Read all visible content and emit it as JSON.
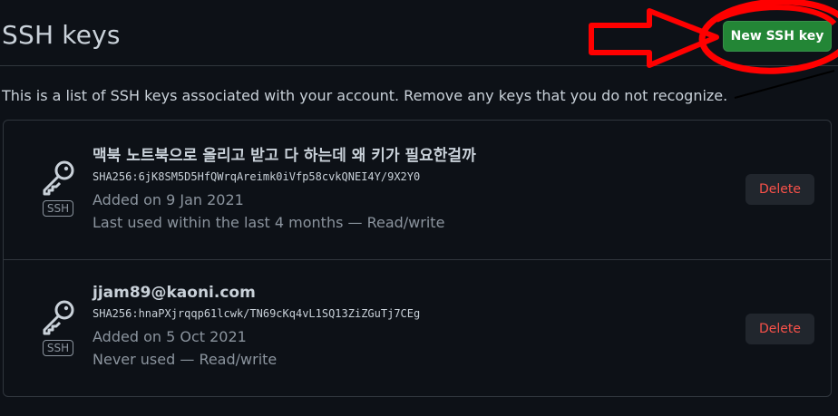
{
  "header": {
    "title": "SSH keys",
    "new_key_label": "New SSH key"
  },
  "description": "This is a list of SSH keys associated with your account. Remove any keys that you do not recognize.",
  "keys": [
    {
      "title": "맥북 노트북으로 올리고 받고 다 하는데 왜 키가 필요한걸까",
      "fingerprint": "SHA256:6jK8SM5D5HfQWrqAreimk0iVfp58cvkQNEI4Y/9X2Y0",
      "added": "Added on 9 Jan 2021",
      "last_used": "Last used within the last 4 months — Read/write",
      "badge": "SSH",
      "delete_label": "Delete",
      "icon": "key-icon"
    },
    {
      "title": "jjam89@kaoni.com",
      "fingerprint": "SHA256:hnaPXjrqqp61lcwk/TN69cKq4vL1SQ13ZiZGuTj7CEg",
      "added": "Added on 5 Oct 2021",
      "last_used": "Never used — Read/write",
      "badge": "SSH",
      "delete_label": "Delete",
      "icon": "key-icon"
    }
  ],
  "colors": {
    "background": "#0d1117",
    "primary_button": "#238636",
    "danger_text": "#f85149",
    "annotation": "#ff0000"
  }
}
